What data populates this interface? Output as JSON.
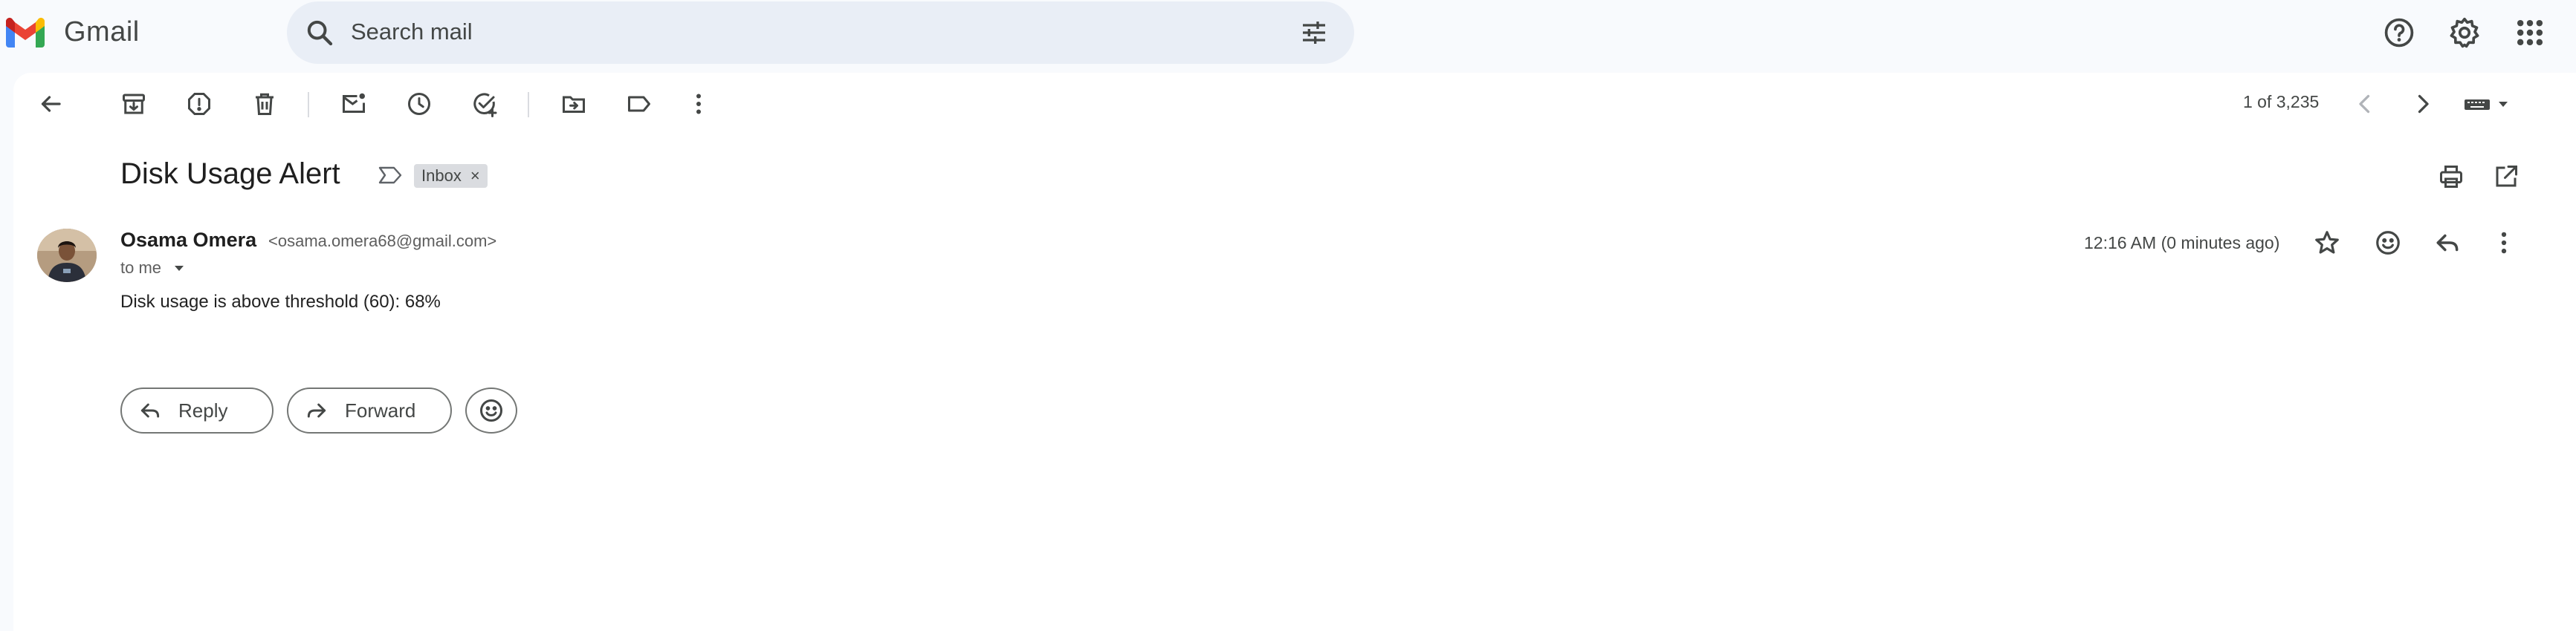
{
  "app": {
    "name": "Gmail"
  },
  "search": {
    "placeholder": "Search mail"
  },
  "toolbar": {
    "pager": "1 of 3,235"
  },
  "message": {
    "subject": "Disk Usage Alert",
    "label_chip": "Inbox",
    "label_remove": "×",
    "sender_name": "Osama Omera",
    "sender_email": "<osama.omera68@gmail.com>",
    "recipient": "to me",
    "time": "12:16 AM (0 minutes ago)",
    "body": "Disk usage is above threshold (60):  68%"
  },
  "actions": {
    "reply": "Reply",
    "forward": "Forward"
  },
  "colors": {
    "background": "#f8fafd",
    "search_bg": "#e9eef6",
    "card_bg": "#ffffff",
    "chip_bg": "#dadce0",
    "icon": "#444746"
  },
  "icons": [
    "gmail-logo-icon",
    "search-icon",
    "tune-icon",
    "help-icon",
    "settings-icon",
    "apps-icon",
    "back-arrow-icon",
    "archive-icon",
    "report-spam-icon",
    "delete-icon",
    "mark-unread-icon",
    "snooze-icon",
    "add-task-icon",
    "move-to-icon",
    "label-icon",
    "more-vert-icon",
    "chevron-left-icon",
    "chevron-right-icon",
    "keyboard-icon",
    "print-icon",
    "open-in-new-icon",
    "importance-marker-icon",
    "star-icon",
    "emoji-icon",
    "reply-icon",
    "forward-icon"
  ]
}
